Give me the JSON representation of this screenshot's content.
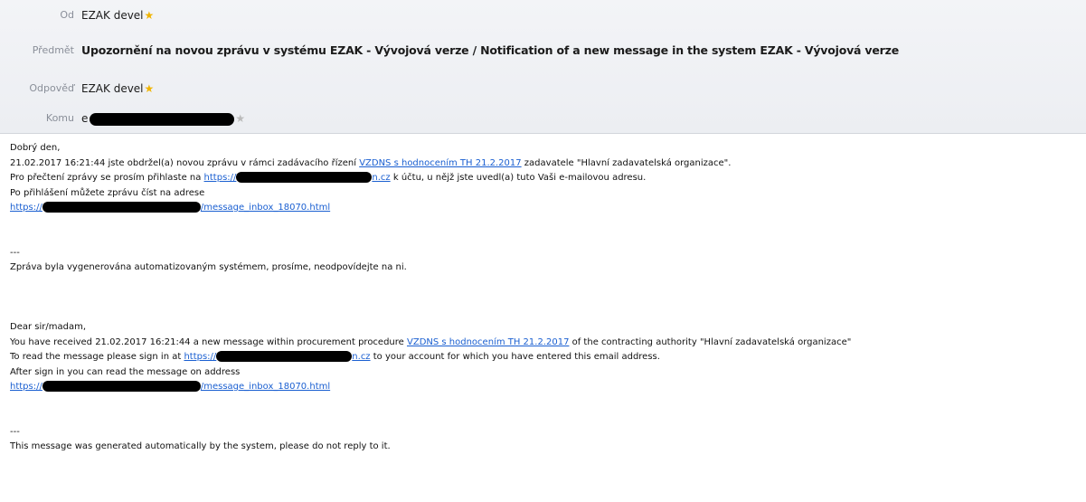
{
  "header": {
    "from_label": "Od",
    "from_value": "EZAK devel",
    "subject_label": "Předmět",
    "subject_value": "Upozornění na novou zprávu v systému EZAK - Vývojová verze / Notification of a new message in the system EZAK - Vývojová verze",
    "reply_label": "Odpověď",
    "reply_value": "EZAK devel",
    "to_label": "Komu",
    "to_value_prefix": "e"
  },
  "cz": {
    "greeting": "Dobrý den,",
    "line1_pre": "21.02.2017 16:21:44 jste obdržel(a) novou zprávu v rámci zadávacího řízení ",
    "line1_link": "VZDNS s hodnocením TH 21.2.2017",
    "line1_post": " zadavatele \"Hlavní zadavatelská organizace\".",
    "line2_pre": "Pro přečtení zprávy se prosím přihlaste na ",
    "line2_link_a": "https://",
    "line2_link_b": "n.cz",
    "line2_post": " k účtu, u nějž jste uvedl(a) tuto Vaši e-mailovou adresu.",
    "line3": "Po přihlášení můžete zprávu číst na adrese",
    "line4_link_a": "https://",
    "line4_link_b": "/message_inbox_18070.html",
    "sep": "---",
    "footer": "Zpráva byla vygenerována automatizovaným systémem, prosíme, neodpovídejte na ni."
  },
  "en": {
    "greeting": "Dear sir/madam,",
    "line1_pre": "You have received 21.02.2017 16:21:44 a new message within procurement procedure ",
    "line1_link": "VZDNS s hodnocením TH 21.2.2017",
    "line1_post": " of the contracting authority \"Hlavní zadavatelská organizace\"",
    "line2_pre": "To read the message please sign in at ",
    "line2_link_a": "https://",
    "line2_link_b": "n.cz",
    "line2_post": " to your account for which you have entered this email address.",
    "line3": "After sign in you can read the message on address",
    "line4_link_a": "https://",
    "line4_link_b": "/message_inbox_18070.html",
    "sep": "---",
    "footer": "This message was generated automatically by the system, please do not reply to it."
  }
}
